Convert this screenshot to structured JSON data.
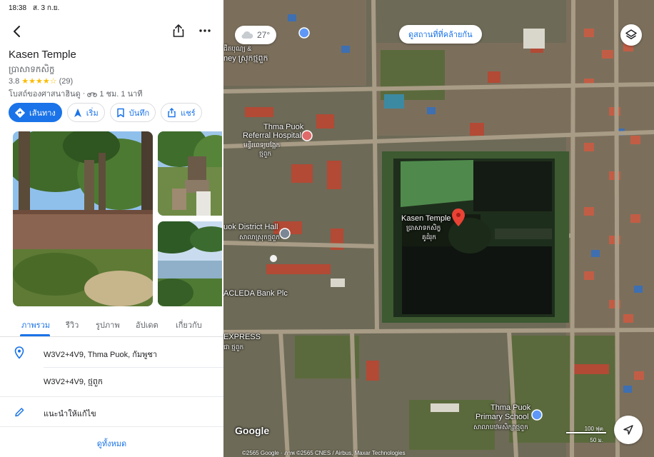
{
  "status_bar": {
    "time": "18:38",
    "date": "ส. 3 ก.ย."
  },
  "place": {
    "name": "Kasen Temple",
    "name_local": "ប្រាសាទកសិក្ខ",
    "rating": "3.8",
    "stars": "★★★★☆",
    "review_count": "(29)",
    "category": "โบสถ์ของศาสนาฮินดู",
    "travel_time": "1 ชม. 1 นาที"
  },
  "actions": {
    "directions": "เส้นทาง",
    "start": "เริ่ม",
    "save": "บันทึก",
    "share": "แชร์"
  },
  "tabs": {
    "overview": "ภาพรวม",
    "reviews": "รีวิว",
    "photos": "รูปภาพ",
    "updates": "อัปเดต",
    "about": "เกี่ยวกับ"
  },
  "info": {
    "plus_code": "W3V2+4V9, Thma Puok, กัมพูชา",
    "plus_code_local": "W3V2+4V9, ថ្មពួក",
    "suggest_edit": "แนะนำให้แก้ไข",
    "see_all": "ดูทั้งหมด"
  },
  "map": {
    "temperature": "27°",
    "similar_places": "ดูสถานที่ที่คล้ายกัน",
    "labels": {
      "temple_name": "Kasen Temple",
      "temple_local": "ប្រាសាទកសិក្ខ",
      "temple_local2": "គូដំរុក",
      "hospital": "Thma Puok",
      "hospital2": "Referral Hospital",
      "hospital_local": "មន្ទីរពេទ្យបង្អែក",
      "hospital_local2": "ថ្មពួក",
      "district_hall": "uok District Hall",
      "district_local": "សាលាស្រុកថ្មពួក",
      "acleda": "ACLEDA Bank Plc",
      "express": "EXPRESS",
      "express_local": "ជា ថ្មពួក",
      "top_label": "ney ស្រុកថ្មពួក",
      "top_label2": "ដឹតបុណ្យ &",
      "school": "Thma Puok",
      "school2": "Primary School",
      "school_local": "សាលាបឋមសិក្សាថ្មពួក"
    },
    "google": "Google",
    "copyright": "©2565 Google · ภาพ ©2565 CNES / Airbus, Maxar Technologies",
    "scale_ft": "100 ฟุต",
    "scale_m": "50 ม."
  },
  "colors": {
    "accent": "#1a73e8",
    "star": "#fbbc04",
    "pin": "#ea4335"
  }
}
